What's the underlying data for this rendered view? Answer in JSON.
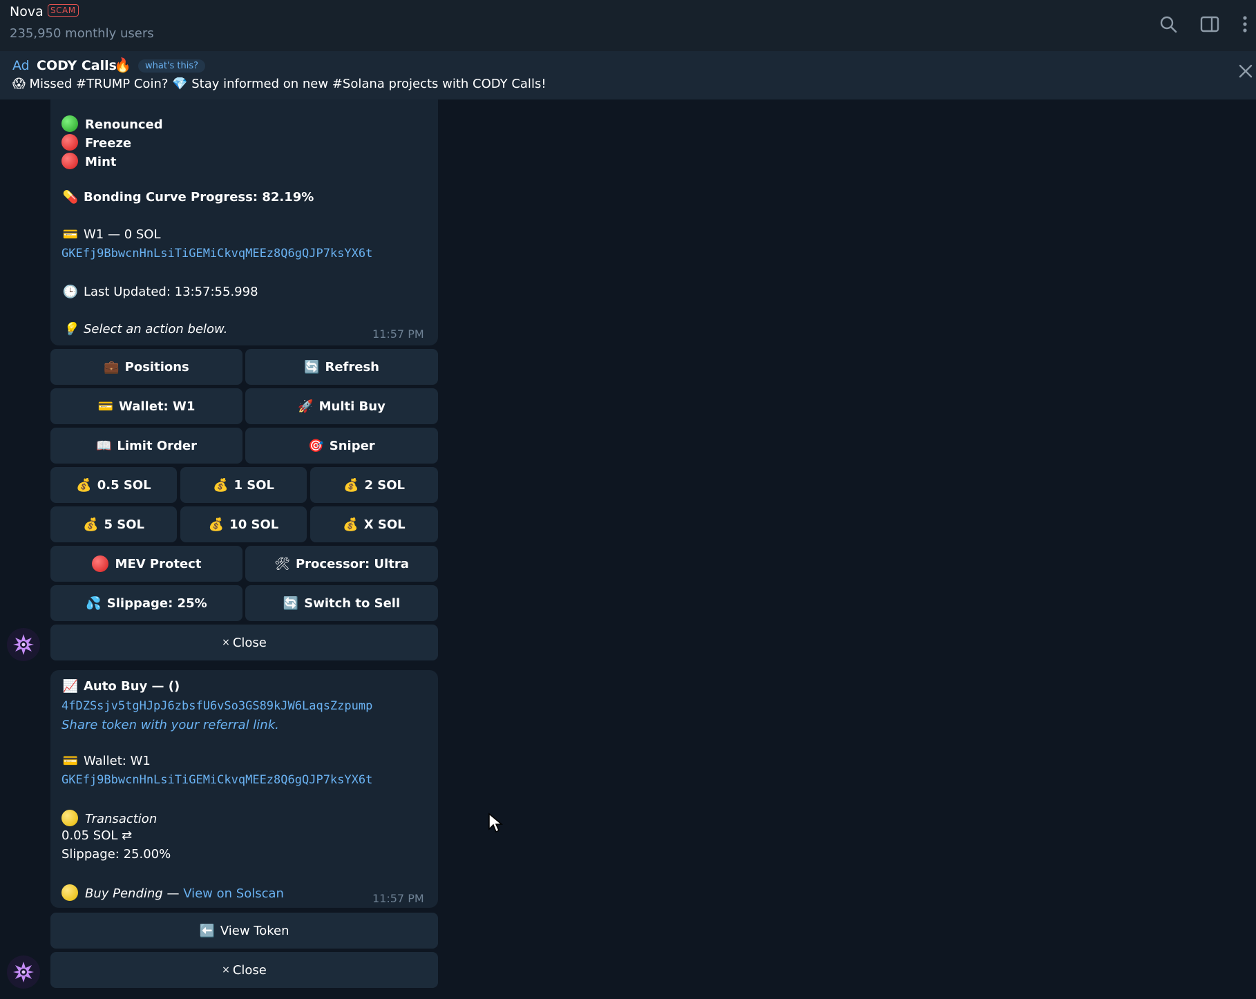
{
  "header": {
    "title": "Nova",
    "scam_badge": "SCAM",
    "subtitle": "235,950 monthly users",
    "icons": [
      "search-icon",
      "sidebar-toggle-icon",
      "more-vertical-icon"
    ]
  },
  "ad": {
    "label": "Ad",
    "title": "CODY Calls",
    "title_emoji": "🔥",
    "whats_this": "what's this?",
    "text": "😱 Missed #TRUMP Coin? 💎 Stay informed on new #Solana projects with CODY Calls!"
  },
  "message1": {
    "renounced": "Renounced",
    "freeze": "Freeze",
    "mint": "Mint",
    "bonding": "Bonding Curve Progress: 82.19%",
    "wallet_line": "W1 — 0 SOL",
    "wallet_address": "GKEfj9BbwcnHnLsiTiGEMiCkvqMEEz8Q6gQJP7ksYX6t",
    "last_updated": "Last Updated: 13:57:55.998",
    "select_action": "Select an action below.",
    "time": "11:57 PM"
  },
  "keyboard1": {
    "positions": "Positions",
    "refresh": "Refresh",
    "wallet": "Wallet: W1",
    "multi_buy": "Multi Buy",
    "limit_order": "Limit Order",
    "sniper": "Sniper",
    "amount_05": "0.5 SOL",
    "amount_1": "1 SOL",
    "amount_2": "2 SOL",
    "amount_5": "5 SOL",
    "amount_10": "10 SOL",
    "amount_x": "X SOL",
    "mev": "MEV Protect",
    "processor": "Processor: Ultra",
    "slippage": "Slippage: 25%",
    "switch": "Switch to Sell",
    "close": "Close",
    "close_prefix": "×"
  },
  "message2": {
    "auto_buy": "Auto Buy  — ()",
    "token_address": "4fDZSsjv5tgHJpJ6zbsfU6vSo3GS89kJW6LaqsZzpump",
    "share": "Share token with your referral link.",
    "wallet": "Wallet: W1",
    "wallet_address": "GKEfj9BbwcnHnLsiTiGEMiCkvqMEEz8Q6gQJP7ksYX6t",
    "transaction": "Transaction",
    "amount": "0.05 SOL ⇄",
    "slippage": "Slippage: 25.00%",
    "pending": "Buy Pending",
    "dash": " — ",
    "solscan": "View on Solscan",
    "time": "11:57 PM"
  },
  "keyboard2": {
    "view_token": "View Token",
    "close": "Close",
    "close_prefix": "×"
  },
  "colors": {
    "header_bg": "#17212b",
    "chat_bg": "#0e1621",
    "bubble_bg": "#182533",
    "button_bg": "#1c2b3a",
    "link": "#6ab2f2",
    "scam": "#e05250"
  }
}
